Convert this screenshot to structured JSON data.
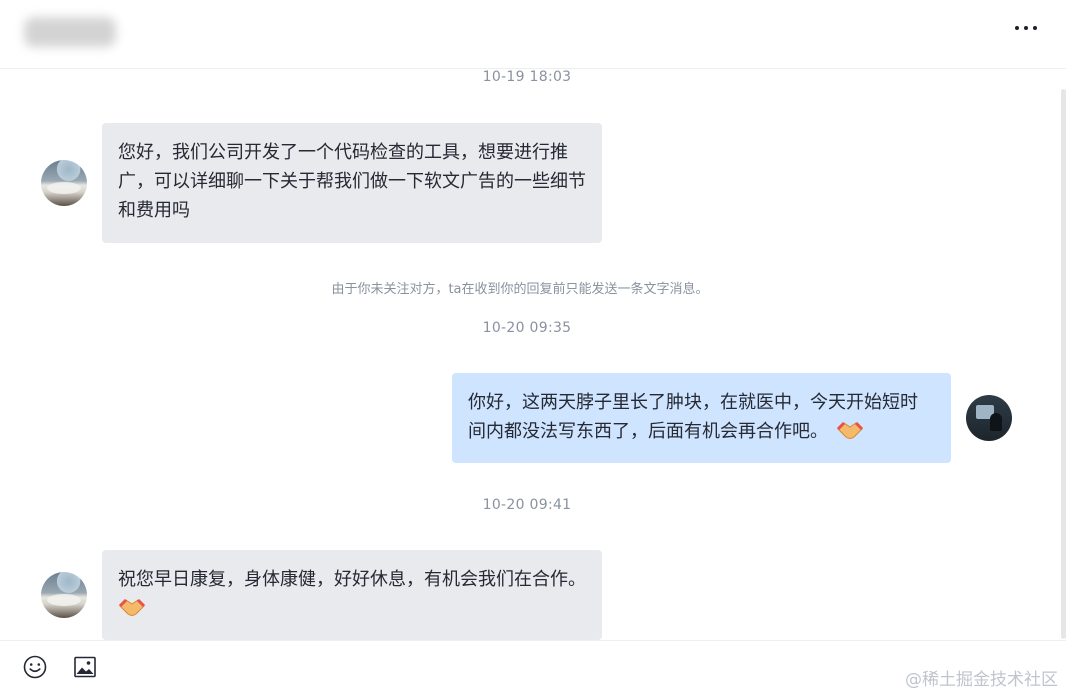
{
  "header": {
    "peer_name": "████",
    "more_icon": "more-horizontal-icon"
  },
  "messages": [
    {
      "type": "timestamp",
      "text": "10-19 18:03"
    },
    {
      "type": "message",
      "sender": "peer",
      "text": "您好，我们公司开发了一个代码检查的工具，想要进行推广，可以详细聊一下关于帮我们做一下软文广告的一些细节和费用吗"
    },
    {
      "type": "notice",
      "text": "由于你未关注对方，ta在收到你的回复前只能发送一条文字消息。"
    },
    {
      "type": "timestamp",
      "text": "10-20 09:35"
    },
    {
      "type": "message",
      "sender": "me",
      "text": "你好，这两天脖子里长了肿块，在就医中，今天开始短时间内都没法写东西了，后面有机会再合作吧。",
      "emoji": "handshake"
    },
    {
      "type": "timestamp",
      "text": "10-20 09:41"
    },
    {
      "type": "message",
      "sender": "peer",
      "text": "祝您早日康复，身体康健，好好休息，有机会我们在合作。",
      "emoji": "handshake"
    }
  ],
  "toolbar": {
    "emoji_icon": "smiley-icon",
    "image_icon": "image-icon"
  },
  "watermark": "@稀土掘金技术社区",
  "colors": {
    "peer_bubble": "#e8eaed",
    "my_bubble": "#cfe4ff",
    "meta_text": "#8a919f"
  }
}
